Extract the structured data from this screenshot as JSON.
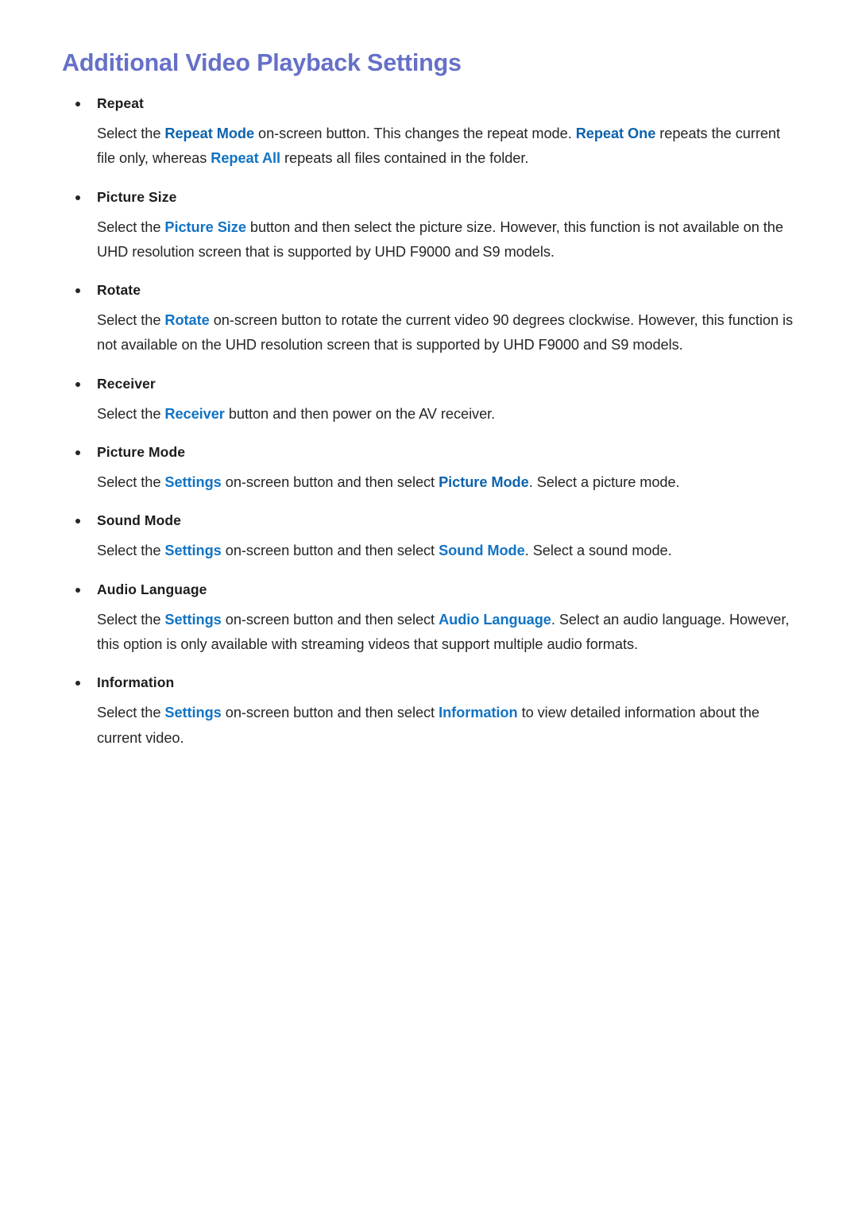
{
  "document": {
    "title": "Additional Video Playback Settings",
    "title_color": "#6670c8",
    "body_color": "#262626",
    "highlight_color": "#1273c4",
    "highlight_color_dark": "#0d63ad",
    "background_color": "#ffffff",
    "bullet_glyph": "•"
  },
  "sections": [
    {
      "label": "Repeat",
      "paragraph": [
        {
          "text": "Select the ",
          "style": "normal"
        },
        {
          "text": "Repeat Mode",
          "style": "highlight-dark"
        },
        {
          "text": " on-screen button. This changes the repeat mode. ",
          "style": "normal"
        },
        {
          "text": "Repeat One",
          "style": "highlight-dark"
        },
        {
          "text": " repeats the current file only, whereas ",
          "style": "normal"
        },
        {
          "text": "Repeat All",
          "style": "highlight"
        },
        {
          "text": " repeats all files contained in the folder.",
          "style": "normal"
        }
      ],
      "plain": "Select the Repeat Mode on-screen button. This changes the repeat mode. Repeat One repeats the current file only, whereas Repeat All repeats all files contained in the folder."
    },
    {
      "label": "Picture Size",
      "paragraph": [
        {
          "text": "Select the ",
          "style": "normal"
        },
        {
          "text": "Picture Size",
          "style": "highlight"
        },
        {
          "text": " button and then select the picture size. However, this function is not available on the UHD resolution screen that is supported by UHD F9000 and S9 models.",
          "style": "normal"
        }
      ],
      "plain": "Select the Picture Size button and then select the picture size. However, this function is not available on the UHD resolution screen that is supported by UHD F9000 and S9 models."
    },
    {
      "label": "Rotate",
      "paragraph": [
        {
          "text": "Select the ",
          "style": "normal"
        },
        {
          "text": "Rotate",
          "style": "highlight"
        },
        {
          "text": " on-screen button to rotate the current video 90 degrees clockwise. However, this function is not available on the UHD resolution screen that is supported by UHD F9000 and S9 models.",
          "style": "normal"
        }
      ],
      "plain": "Select the Rotate on-screen button to rotate the current video 90 degrees clockwise. However, this function is not available on the UHD resolution screen that is supported by UHD F9000 and S9 models."
    },
    {
      "label": "Receiver",
      "paragraph": [
        {
          "text": "Select the ",
          "style": "normal"
        },
        {
          "text": "Receiver",
          "style": "highlight"
        },
        {
          "text": " button and then power on the AV receiver.",
          "style": "normal"
        }
      ],
      "plain": "Select the Receiver button and then power on the AV receiver."
    },
    {
      "label": "Picture Mode",
      "paragraph": [
        {
          "text": "Select the ",
          "style": "normal"
        },
        {
          "text": "Settings",
          "style": "highlight"
        },
        {
          "text": " on-screen button and then select ",
          "style": "normal"
        },
        {
          "text": "Picture Mode",
          "style": "highlight-dark"
        },
        {
          "text": ". Select a picture mode.",
          "style": "normal"
        }
      ],
      "plain": "Select the Settings on-screen button and then select Picture Mode. Select a picture mode."
    },
    {
      "label": "Sound Mode",
      "paragraph": [
        {
          "text": "Select the ",
          "style": "normal"
        },
        {
          "text": "Settings",
          "style": "highlight"
        },
        {
          "text": " on-screen button and then select ",
          "style": "normal"
        },
        {
          "text": "Sound Mode",
          "style": "highlight"
        },
        {
          "text": ". Select a sound mode.",
          "style": "normal"
        }
      ],
      "plain": "Select the Settings on-screen button and then select Sound Mode. Select a sound mode."
    },
    {
      "label": "Audio Language",
      "paragraph": [
        {
          "text": "Select the ",
          "style": "normal"
        },
        {
          "text": "Settings",
          "style": "highlight"
        },
        {
          "text": " on-screen button and then select ",
          "style": "normal"
        },
        {
          "text": "Audio Language",
          "style": "highlight"
        },
        {
          "text": ". Select an audio language. However, this option is only available with streaming videos that support multiple audio formats.",
          "style": "normal"
        }
      ],
      "plain": "Select the Settings on-screen button and then select Audio Language. Select an audio language. However, this option is only available with streaming videos that support multiple audio formats."
    },
    {
      "label": "Information",
      "paragraph": [
        {
          "text": "Select the ",
          "style": "normal"
        },
        {
          "text": "Settings",
          "style": "highlight"
        },
        {
          "text": " on-screen button and then select ",
          "style": "normal"
        },
        {
          "text": "Information",
          "style": "highlight"
        },
        {
          "text": " to view detailed information about the current video.",
          "style": "normal"
        }
      ],
      "plain": "Select the Settings on-screen button and then select Information to view detailed information about the current video."
    }
  ]
}
